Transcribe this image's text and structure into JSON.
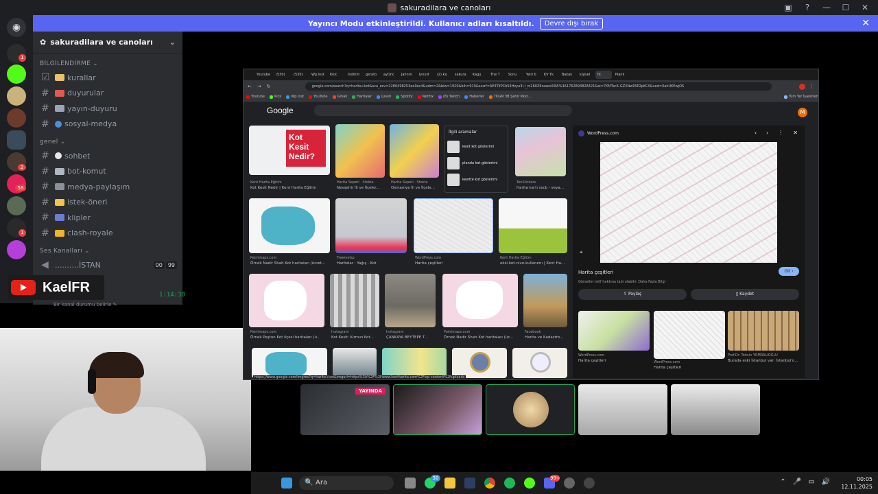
{
  "window": {
    "title": "sakuradilara ve canoları",
    "controls": [
      "▣",
      "?",
      "—",
      "☐",
      "✕"
    ]
  },
  "banner": {
    "text": "Yayıncı Modu etkinleştirildi. Kullanıcı adları kısaltıldı.",
    "button": "Devre dışı bırak",
    "close": "✕"
  },
  "rail": {
    "badges": [
      "1",
      "2",
      "58",
      "1"
    ]
  },
  "server": {
    "name": "sakuradilara ve canoları",
    "chevron": "⌄",
    "categories": [
      {
        "name": "BİLGİLENDİRME ⌄",
        "channels": [
          "kurallar",
          "duyurular",
          "yayın-duyuru",
          "sosyal-medya"
        ]
      },
      {
        "name": "genel ⌄",
        "channels": [
          "sohbet",
          "bot-komut",
          "medya-paylaşım",
          "istek-öneri",
          "klipler",
          "clash-royale"
        ]
      },
      {
        "name": "Ses Kanalları ⌄",
        "channels": [
          "..........İSTAN"
        ]
      }
    ],
    "voice_badges": [
      "00",
      "99"
    ],
    "timer": "1:14:30",
    "status_line": "Bir kanal durumu belirle ✎"
  },
  "overlay": {
    "channel_name": "KaelFR"
  },
  "browser": {
    "tabs": [
      "Youtube",
      "(530)",
      "(530)",
      "Wp.lnst",
      "Kick",
      "Indirim",
      "gerato",
      "ayOnc",
      "Jahnm",
      "lynxst",
      "(2) ka",
      "sakura",
      "Kagu",
      "The T",
      "Sonu",
      "Yeni b",
      "KV Tk",
      "Bakalı",
      "kişisel",
      "ht",
      "Plank"
    ],
    "url": "google.com/search?q=harita+kot&sca_esv=2286498253ea9ec4&udm=2&biw=1920&bih=919&sxsrf=AE3TifPCb54Hzyu3i-l_m260Z6nuwoXWA%3A1762894828421&ei=7KMTac6-GZXNwPAP2pKCA&ved=0ahUKEwjOS",
    "bookmarks": [
      "Youtube",
      "Kick",
      "Wp.lnst",
      "YouTube",
      "Gmail",
      "Haritalar",
      "Çeviri",
      "Spotify",
      "Netflix",
      "(8) Twitch",
      "Haberler",
      "TKGM 3B Şehir Mod...",
      "Tüm Yer İşaretleri"
    ],
    "google_logo": "Google",
    "avatar_letter": "M",
    "results": [
      {
        "source": "Kent Harita Eğitim",
        "title": "Kot Kesit Nedir | Kent Harita Eğitim"
      },
      {
        "source": "Harita Sepeti · Stokta",
        "title": "Nevşehir İli ve İlçeler..."
      },
      {
        "source": "Harita Sepeti · Stokta",
        "title": "Osmaniye İli ve İlçele..."
      },
      {
        "source": "TenStickers",
        "title": "Harita kartı sscb - veya..."
      },
      {
        "source": "Paintmaps.com",
        "title": "Örnek Nadir Shah Kot haritaları (ücret..."
      },
      {
        "source": "Freemelsp",
        "title": "Haritalar : Yağış - Kot"
      },
      {
        "source": "WordPress.com",
        "title": "Harita çeşitleri"
      },
      {
        "source": "Kent Harita Eğitim",
        "title": "eksi-kot-nivo-kullanımı | Kent Ha..."
      },
      {
        "source": "Paintmaps.com",
        "title": "Örnek Peştun Kot ilçesi haritaları (ü..."
      },
      {
        "source": "Instagram",
        "title": "Kot Kesit: Kırmızı Kot..."
      },
      {
        "source": "Instagram",
        "title": "ÇANKAYA BEYTEPE T..."
      },
      {
        "source": "Paintmaps.com",
        "title": "Örnek Nadir Shah Kot haritaları (üc..."
      },
      {
        "source": "Facebook",
        "title": "Harita ve Kadastro..."
      }
    ],
    "kot_overlay": "Kot Kesit Nedir?",
    "related": {
      "title": "İlgili aramalar",
      "items": [
        "kesit kot gösterimi",
        "planda kot gösterimi",
        "kesitte kot gösterimi"
      ]
    },
    "panel": {
      "site": "WordPress.com",
      "title": "Harita çeşitleri",
      "sub": "Görseller telif hakkına tabi olabilir. Daha Fazla Bilgi",
      "go": "Git ›",
      "share": "Paylaş",
      "save": "Kaydet",
      "mini": [
        {
          "source": "WordPress.com",
          "title": "Harita çeşitleri"
        },
        {
          "source": "WordPress.com",
          "title": "Harita çeşitleri"
        },
        {
          "source": "Prof.Dr. Tahsin YOMRALIOĞLU",
          "title": "Burada eski İstanbul var: İstanbul'u..."
        }
      ]
    },
    "status_url": "https://www.google.com/imgres?q=harita+kot&imgurl=https%3A%2F%2Fwww.kentharita.com%2Fwp-content%2Fuploads"
  },
  "streams": {
    "live_label": "YAYINDA"
  },
  "taskbar": {
    "search_placeholder": "Ara",
    "search_icon": "🔍",
    "badges": [
      "30",
      "99+"
    ],
    "tray": [
      "⌃",
      "🎤",
      "▭",
      "🔊"
    ],
    "time": "00:05",
    "date": "12.11.2025"
  },
  "colors": {
    "blurple": "#5865f2",
    "green": "#23a55a",
    "red": "#f23f43"
  }
}
